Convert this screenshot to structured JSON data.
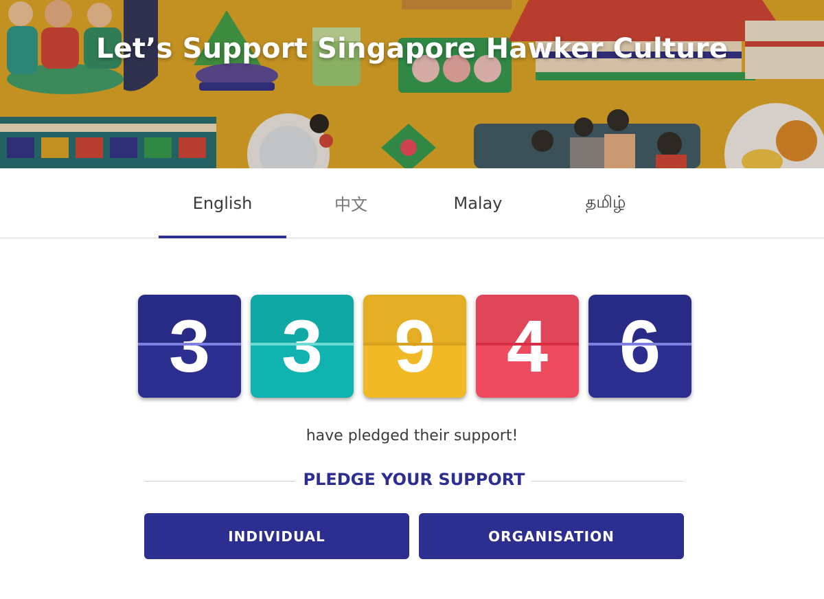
{
  "hero": {
    "title": "Let’s Support Singapore Hawker Culture"
  },
  "tabs": [
    {
      "label": "English",
      "active": true
    },
    {
      "label": "中文",
      "active": false
    },
    {
      "label": "Malay",
      "active": false
    },
    {
      "label": "தமிழ்",
      "active": false
    }
  ],
  "counter": {
    "digits": [
      "3",
      "3",
      "9",
      "4",
      "6"
    ],
    "colors": [
      "#2c2f8f",
      "#10b3b0",
      "#f2b927",
      "#ee4b5f",
      "#2c2f8f"
    ],
    "caption": "have pledged their support!"
  },
  "pledge": {
    "heading": "PLEDGE YOUR SUPPORT",
    "individual_label": "INDIVIDUAL",
    "organisation_label": "ORGANISATION"
  },
  "colors": {
    "brand": "#2c2f8f",
    "hero_bg": "#e0a92a"
  }
}
